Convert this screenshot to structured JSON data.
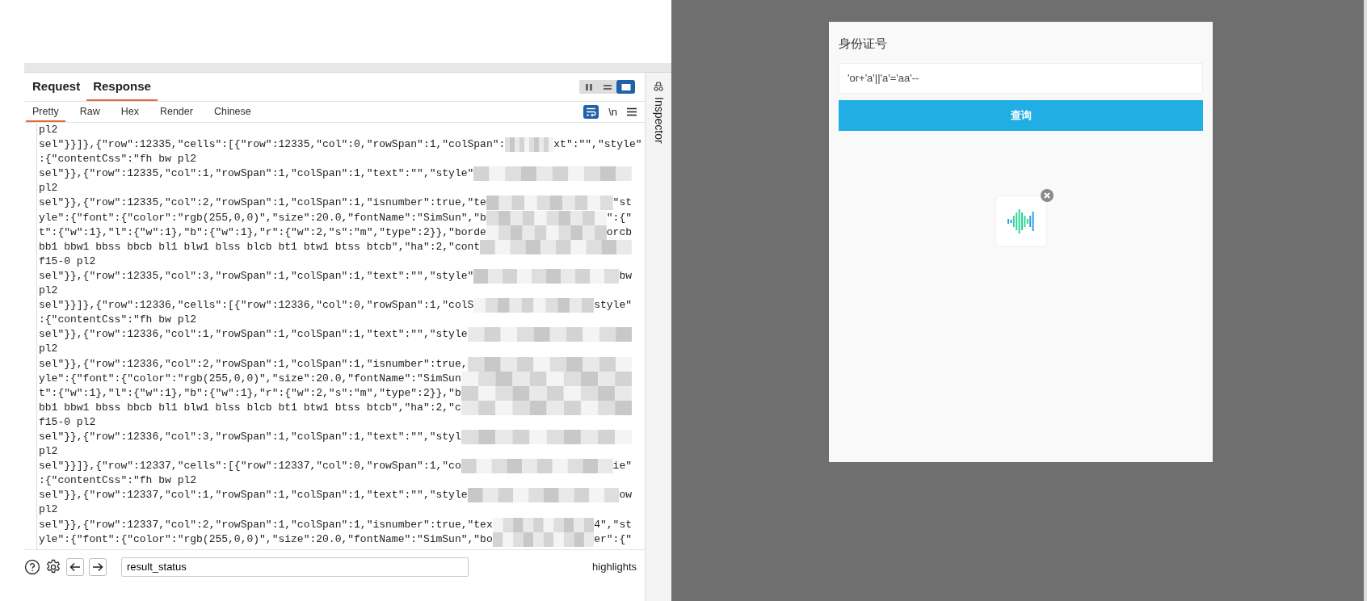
{
  "request_tabs": [
    {
      "label": "Request",
      "selected": false
    },
    {
      "label": "Response",
      "selected": true
    }
  ],
  "view_modes": [
    {
      "kind": "columns",
      "selected": false
    },
    {
      "kind": "rows",
      "selected": false
    },
    {
      "kind": "single",
      "selected": true
    }
  ],
  "subtabs": [
    {
      "label": "Pretty",
      "selected": true
    },
    {
      "label": "Raw",
      "selected": false
    },
    {
      "label": "Hex",
      "selected": false
    },
    {
      "label": "Render",
      "selected": false
    },
    {
      "label": "Chinese",
      "selected": false
    }
  ],
  "editor_tools": {
    "wrap_selected": true,
    "newline_label": "\\n"
  },
  "code_lines": [
    {
      "text": "pl2",
      "redacted": false
    },
    {
      "text": "sel\"}}]},{\"row\":12335,\"cells\":[{\"row\":12335,\"col\":0,\"rowSpan\":1,\"colSpan\":",
      "redacted": true,
      "tail": "xt\":\"\",\"style\""
    },
    {
      "text": ":{\"contentCss\":\"fh bw pl2",
      "redacted": false
    },
    {
      "text": "sel\"}},{\"row\":12335,\"col\":1,\"rowSpan\":1,\"colSpan\":1,\"text\":\"\",\"style\"",
      "redacted": true
    },
    {
      "text": "pl2",
      "redacted": false
    },
    {
      "text": "sel\"}},{\"row\":12335,\"col\":2,\"rowSpan\":1,\"colSpan\":1,\"isnumber\":true,\"te",
      "redacted": true,
      "tail": "\"st"
    },
    {
      "text": "yle\":{\"font\":{\"color\":\"rgb(255,0,0)\",\"size\":20.0,\"fontName\":\"SimSun\",\"b",
      "redacted": true,
      "tail": "\":{\""
    },
    {
      "text": "t\":{\"w\":1},\"l\":{\"w\":1},\"b\":{\"w\":1},\"r\":{\"w\":2,\"s\":\"m\",\"type\":2}},\"borde",
      "redacted": true,
      "tail": "orcb"
    },
    {
      "text": "bb1 bbw1 bbss bbcb bl1 blw1 blss blcb bt1 btw1 btss btcb\",\"ha\":2,\"cont",
      "redacted": true
    },
    {
      "text": "f15-0 pl2",
      "redacted": false
    },
    {
      "text": "sel\"}},{\"row\":12335,\"col\":3,\"rowSpan\":1,\"colSpan\":1,\"text\":\"\",\"style\"",
      "redacted": true,
      "tail": "bw"
    },
    {
      "text": "pl2",
      "redacted": false
    },
    {
      "text": "sel\"}}]},{\"row\":12336,\"cells\":[{\"row\":12336,\"col\":0,\"rowSpan\":1,\"colS",
      "redacted": true,
      "tail": "style\""
    },
    {
      "text": ":{\"contentCss\":\"fh bw pl2",
      "redacted": false
    },
    {
      "text": "sel\"}},{\"row\":12336,\"col\":1,\"rowSpan\":1,\"colSpan\":1,\"text\":\"\",\"style",
      "redacted": true
    },
    {
      "text": "pl2",
      "redacted": false
    },
    {
      "text": "sel\"}},{\"row\":12336,\"col\":2,\"rowSpan\":1,\"colSpan\":1,\"isnumber\":true,",
      "redacted": true
    },
    {
      "text": "yle\":{\"font\":{\"color\":\"rgb(255,0,0)\",\"size\":20.0,\"fontName\":\"SimSun",
      "redacted": true
    },
    {
      "text": "t\":{\"w\":1},\"l\":{\"w\":1},\"b\":{\"w\":1},\"r\":{\"w\":2,\"s\":\"m\",\"type\":2}},\"b",
      "redacted": true
    },
    {
      "text": "bb1 bbw1 bbss bbcb bl1 blw1 blss blcb bt1 btw1 btss btcb\",\"ha\":2,\"c",
      "redacted": true
    },
    {
      "text": "f15-0 pl2",
      "redacted": false
    },
    {
      "text": "sel\"}},{\"row\":12336,\"col\":3,\"rowSpan\":1,\"colSpan\":1,\"text\":\"\",\"styl",
      "redacted": true
    },
    {
      "text": "pl2",
      "redacted": false
    },
    {
      "text": "sel\"}}]},{\"row\":12337,\"cells\":[{\"row\":12337,\"col\":0,\"rowSpan\":1,\"co",
      "redacted": true,
      "tail": "ie\""
    },
    {
      "text": ":{\"contentCss\":\"fh bw pl2",
      "redacted": false
    },
    {
      "text": "sel\"}},{\"row\":12337,\"col\":1,\"rowSpan\":1,\"colSpan\":1,\"text\":\"\",\"style",
      "redacted": true,
      "tail": "ow"
    },
    {
      "text": "pl2",
      "redacted": false
    },
    {
      "text": "sel\"}},{\"row\":12337,\"col\":2,\"rowSpan\":1,\"colSpan\":1,\"isnumber\":true,\"tex",
      "redacted": true,
      "tail": "4\",\"st"
    },
    {
      "text": "yle\":{\"font\":{\"color\":\"rgb(255,0,0)\",\"size\":20.0,\"fontName\":\"SimSun\",\"bo",
      "redacted": true,
      "tail": "er\":{\""
    }
  ],
  "search": {
    "value": "result_status"
  },
  "highlights": "highlights",
  "side_panel": {
    "label": "Inspector"
  },
  "form": {
    "label": "身份证号",
    "value": "'or+'a'||'a'='aa'--",
    "button": "查询"
  },
  "attachment": {
    "kind": "audio"
  }
}
